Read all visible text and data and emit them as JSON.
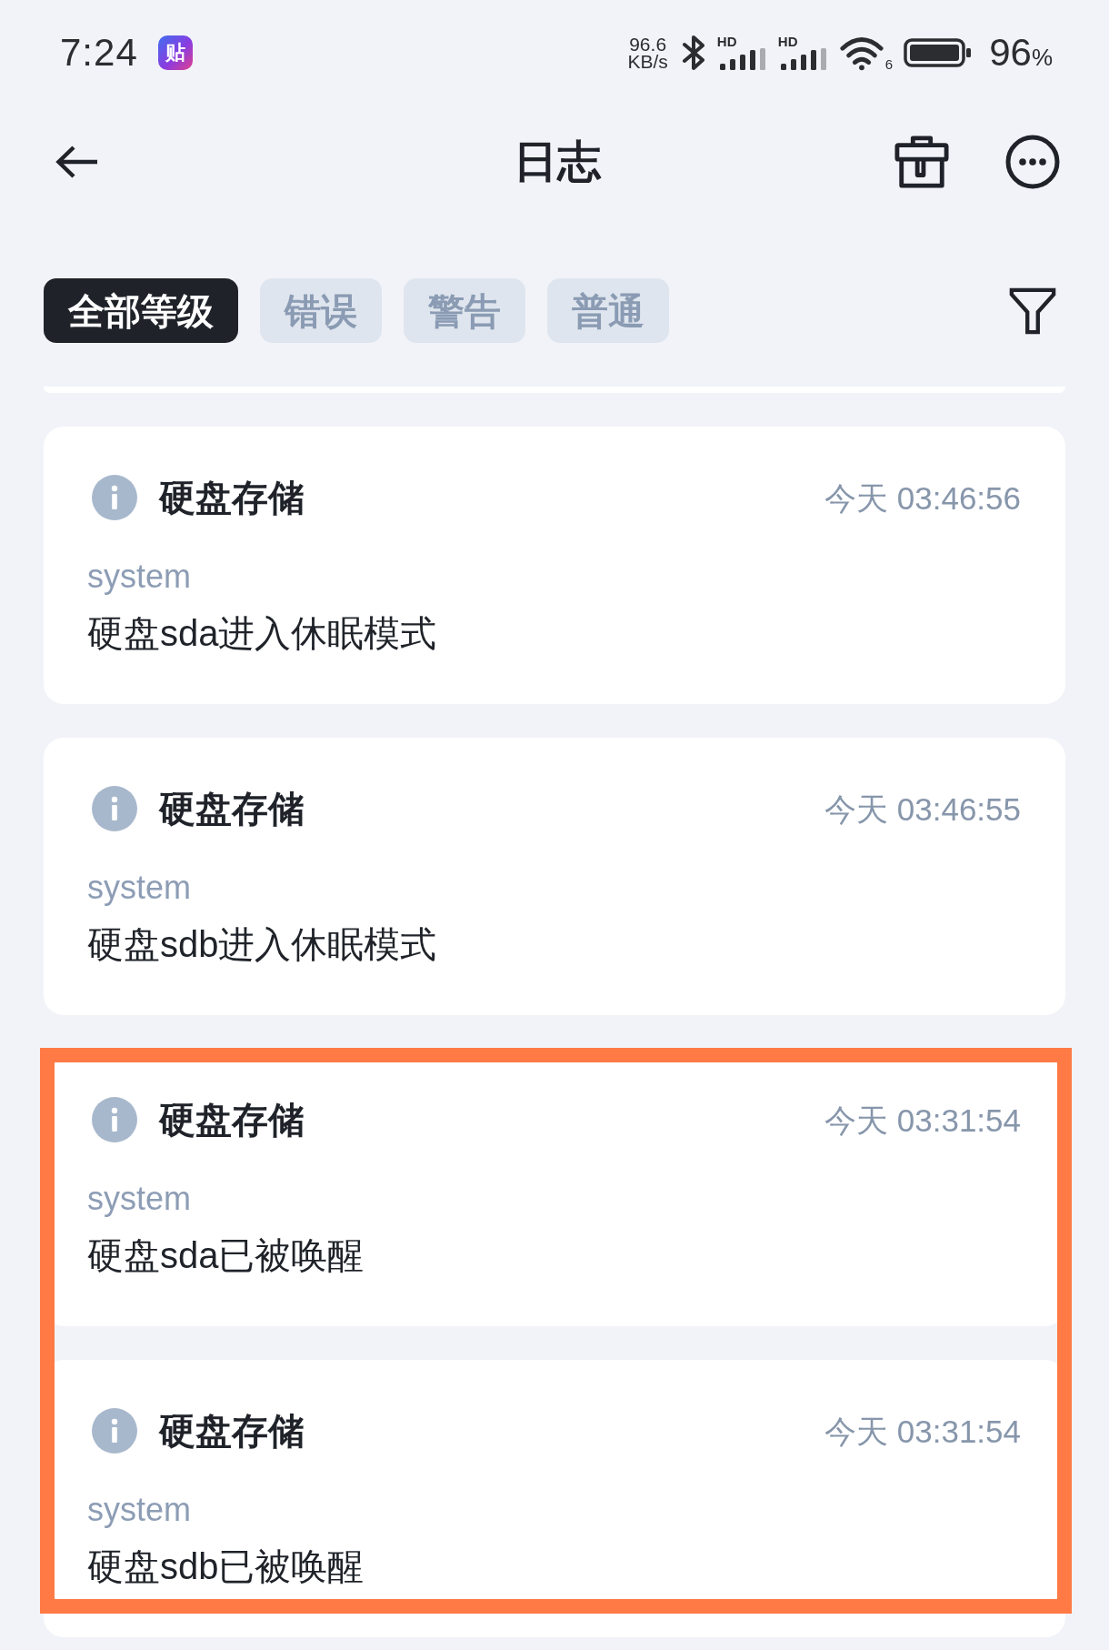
{
  "status_bar": {
    "time": "7:24",
    "app_glyph": "贴",
    "net_speed": {
      "value": "96.6",
      "unit": "KB/s"
    },
    "signals": [
      {
        "label": "HD"
      },
      {
        "label": "HD"
      }
    ],
    "wifi": {
      "label": "6"
    },
    "battery": {
      "value": "96",
      "unit": "%"
    }
  },
  "header": {
    "title": "日志"
  },
  "filters": [
    {
      "label": "全部等级",
      "selected": true
    },
    {
      "label": "错误",
      "selected": false
    },
    {
      "label": "警告",
      "selected": false
    },
    {
      "label": "普通",
      "selected": false
    }
  ],
  "log_list": {
    "partial_card_above": true,
    "entries": [
      {
        "kind": "info",
        "title": "硬盘存储",
        "time": "今天 03:46:56",
        "source": "system",
        "message": "硬盘sda进入休眠模式",
        "highlighted": false
      },
      {
        "kind": "info",
        "title": "硬盘存储",
        "time": "今天 03:46:55",
        "source": "system",
        "message": "硬盘sdb进入休眠模式",
        "highlighted": false
      },
      {
        "kind": "info",
        "title": "硬盘存储",
        "time": "今天 03:31:54",
        "source": "system",
        "message": "硬盘sda已被唤醒",
        "highlighted": true
      },
      {
        "kind": "info",
        "title": "硬盘存储",
        "time": "今天 03:31:54",
        "source": "system",
        "message": "硬盘sdb已被唤醒",
        "highlighted": true
      }
    ]
  }
}
